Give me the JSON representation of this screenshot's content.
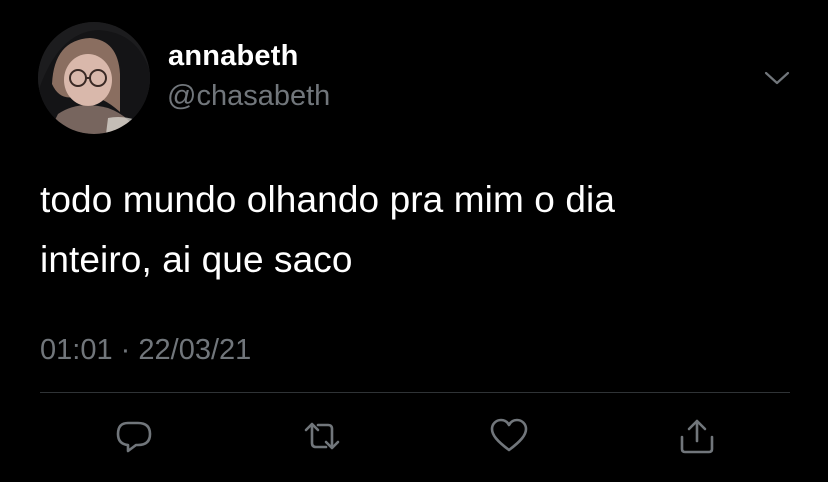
{
  "user": {
    "display_name": "annabeth",
    "handle": "@chasabeth"
  },
  "tweet": {
    "lines": [
      "todo mundo olhando pra mim o dia",
      "inteiro, ai que saco"
    ],
    "time": "01:01",
    "separator": "·",
    "date": "22/03/21"
  },
  "icons": {
    "menu": "chevron-down-icon",
    "reply": "speech-bubble-icon",
    "retweet": "retweet-arrows-icon",
    "like": "heart-icon",
    "share": "share-upload-icon"
  },
  "colors": {
    "background": "#000000",
    "primary_text": "#ffffff",
    "secondary_text": "#71767b",
    "divider": "#2f3336"
  }
}
